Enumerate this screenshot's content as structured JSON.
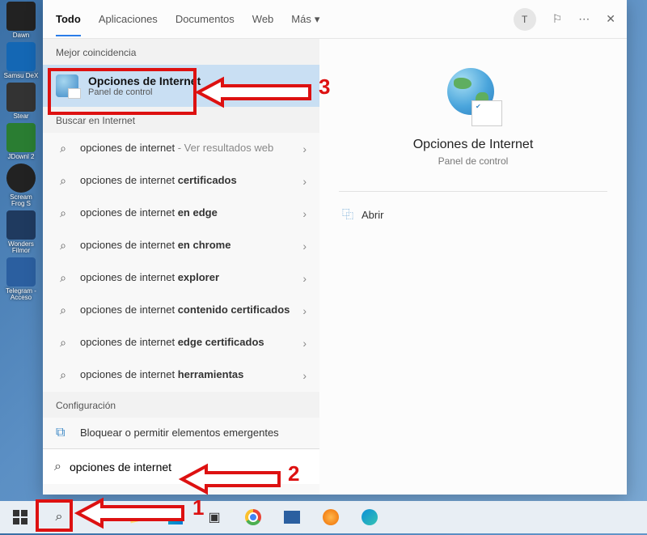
{
  "tabs": {
    "todo": "Todo",
    "apps": "Aplicaciones",
    "docs": "Documentos",
    "web": "Web",
    "more": "Más"
  },
  "avatar_letter": "T",
  "sections": {
    "best_match": "Mejor coincidencia",
    "search_internet": "Buscar en Internet",
    "config": "Configuración"
  },
  "best": {
    "title": "Opciones de Internet",
    "subtitle": "Panel de control"
  },
  "searches": [
    {
      "prefix": "opciones de internet",
      "suffix": " - ",
      "muted": "Ver resultados web",
      "bold": ""
    },
    {
      "prefix": "opciones de internet ",
      "bold": "certificados"
    },
    {
      "prefix": "opciones de internet ",
      "bold": "en edge"
    },
    {
      "prefix": "opciones de internet ",
      "bold": "en chrome"
    },
    {
      "prefix": "opciones de internet ",
      "bold": "explorer"
    },
    {
      "prefix": "opciones de internet ",
      "bold": "contenido certificados"
    },
    {
      "prefix": "opciones de internet ",
      "bold": "edge certificados"
    },
    {
      "prefix": "opciones de internet ",
      "bold": "herramientas"
    }
  ],
  "config_item": "Bloquear o permitir elementos emergentes",
  "search_value": "opciones de internet",
  "preview": {
    "title": "Opciones de Internet",
    "subtitle": "Panel de control",
    "open": "Abrir"
  },
  "anno": {
    "n1": "1",
    "n2": "2",
    "n3": "3"
  },
  "desktop": [
    "Dawn",
    "Samsu DeX",
    "Stear",
    "JDownl 2",
    "Scream Frog S",
    "Wonders Filmor",
    "Telegram - Acceso"
  ]
}
